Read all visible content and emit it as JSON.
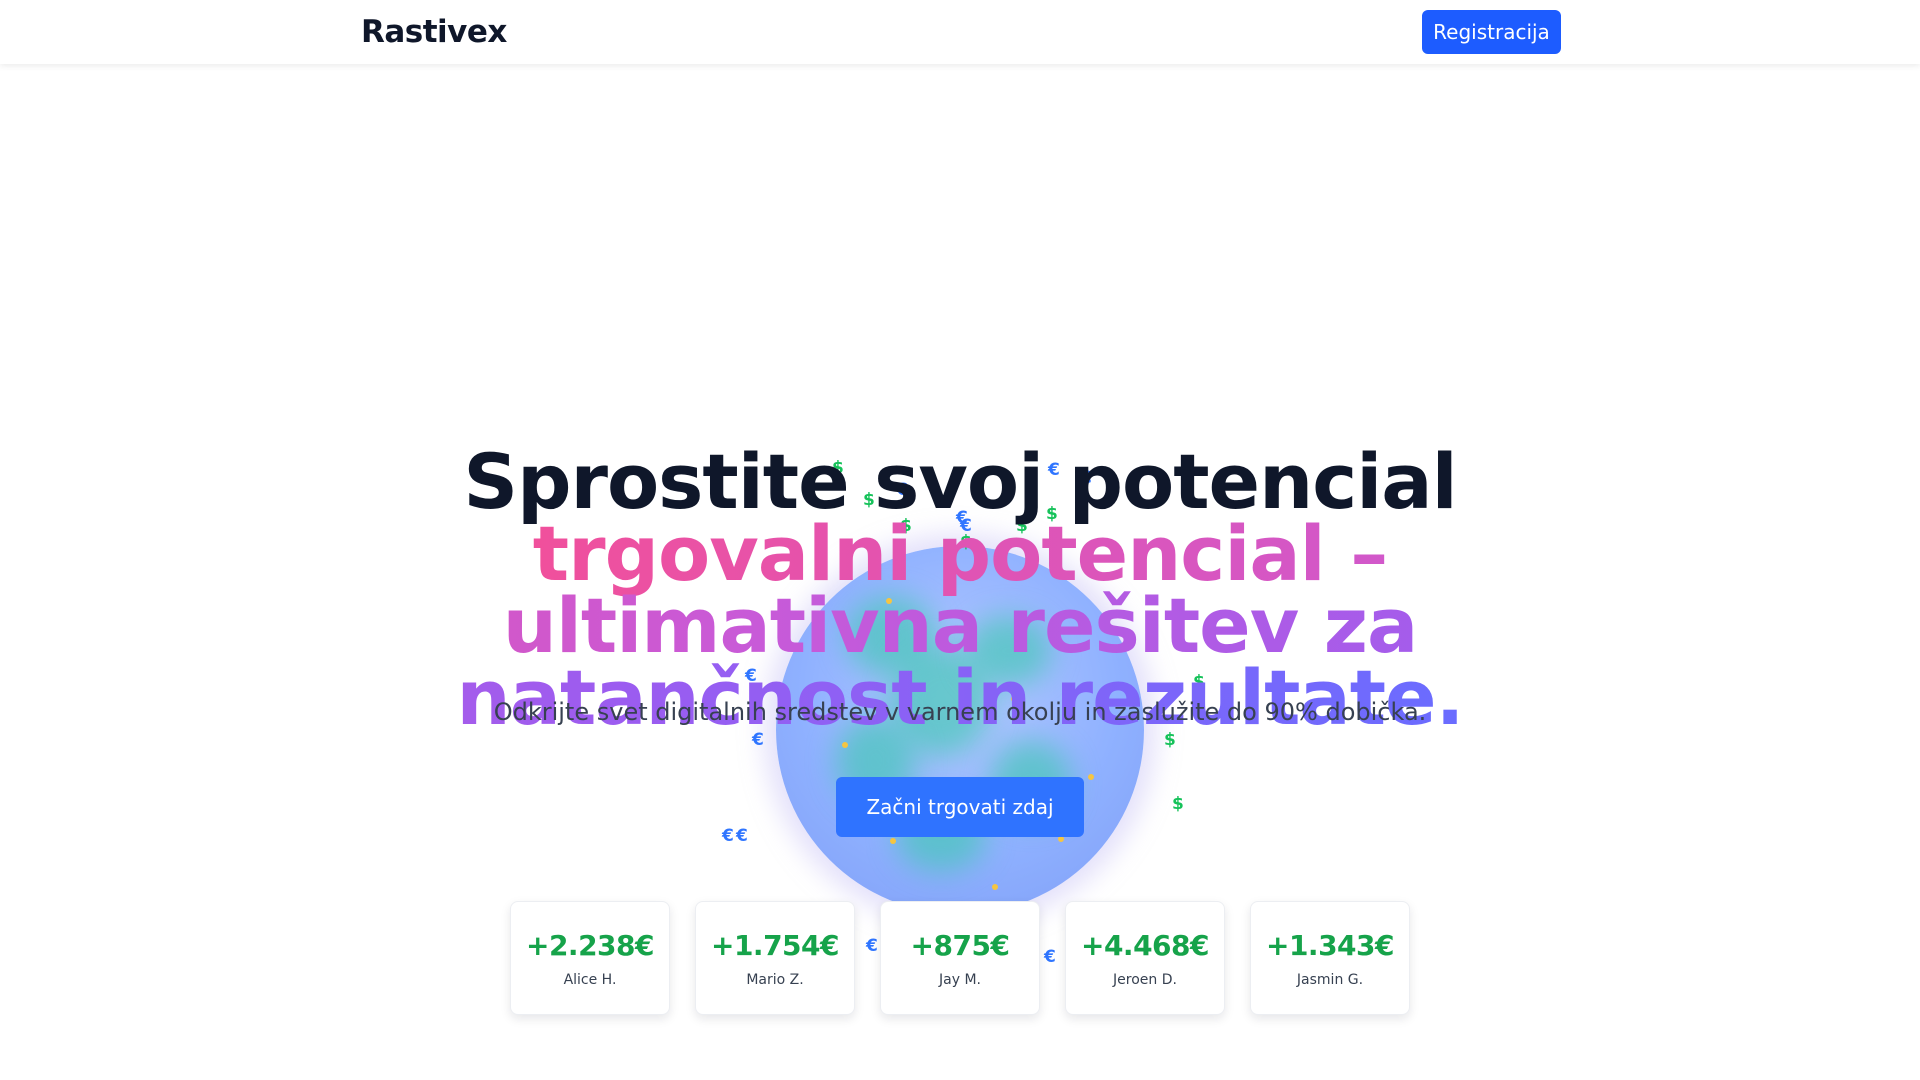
{
  "header": {
    "brand": "Rastivex",
    "register_label": "Registracija"
  },
  "hero": {
    "title_lead": "Sprostite svoj potencial",
    "title_highlight": "trgovalni potencial – ultimativna rešitev za natančnost in rezultate.",
    "subtitle": "Odkrijte svet digitalnih sredstev v varnem okolju in zaslužite do 90% dobička.",
    "cta_label": "Začni trgovati zdaj"
  },
  "colors": {
    "accent": "#1d5cff",
    "profit_green": "#16a34a",
    "gradient_start": "#f0509c",
    "gradient_end": "#6a6cff"
  },
  "icons": [
    "dollar-icon",
    "euro-icon"
  ],
  "coins": [
    {
      "symbol": "$",
      "kind": "usd"
    },
    {
      "symbol": "€",
      "kind": "eur"
    },
    {
      "symbol": "$",
      "kind": "usd"
    },
    {
      "symbol": "€",
      "kind": "eur"
    },
    {
      "symbol": "$",
      "kind": "usd"
    },
    {
      "symbol": "€",
      "kind": "eur"
    },
    {
      "symbol": "$",
      "kind": "usd"
    },
    {
      "symbol": "€",
      "kind": "eur"
    },
    {
      "symbol": "$",
      "kind": "usd"
    },
    {
      "symbol": "$",
      "kind": "usd"
    },
    {
      "symbol": "€",
      "kind": "eur"
    },
    {
      "symbol": "$",
      "kind": "usd"
    },
    {
      "symbol": "€",
      "kind": "eur"
    },
    {
      "symbol": "$",
      "kind": "usd"
    },
    {
      "symbol": "€",
      "kind": "eur"
    },
    {
      "symbol": "$",
      "kind": "usd"
    },
    {
      "symbol": "€",
      "kind": "eur"
    },
    {
      "symbol": "€",
      "kind": "eur"
    },
    {
      "symbol": "$",
      "kind": "usd"
    },
    {
      "symbol": "€",
      "kind": "eur"
    },
    {
      "symbol": "€",
      "kind": "eur"
    }
  ],
  "testimonials": [
    {
      "amount": "+2.238€",
      "name": "Alice H."
    },
    {
      "amount": "+1.754€",
      "name": "Mario Z."
    },
    {
      "amount": "+875€",
      "name": "Jay M."
    },
    {
      "amount": "+4.468€",
      "name": "Jeroen D."
    },
    {
      "amount": "+1.343€",
      "name": "Jasmin G."
    }
  ]
}
